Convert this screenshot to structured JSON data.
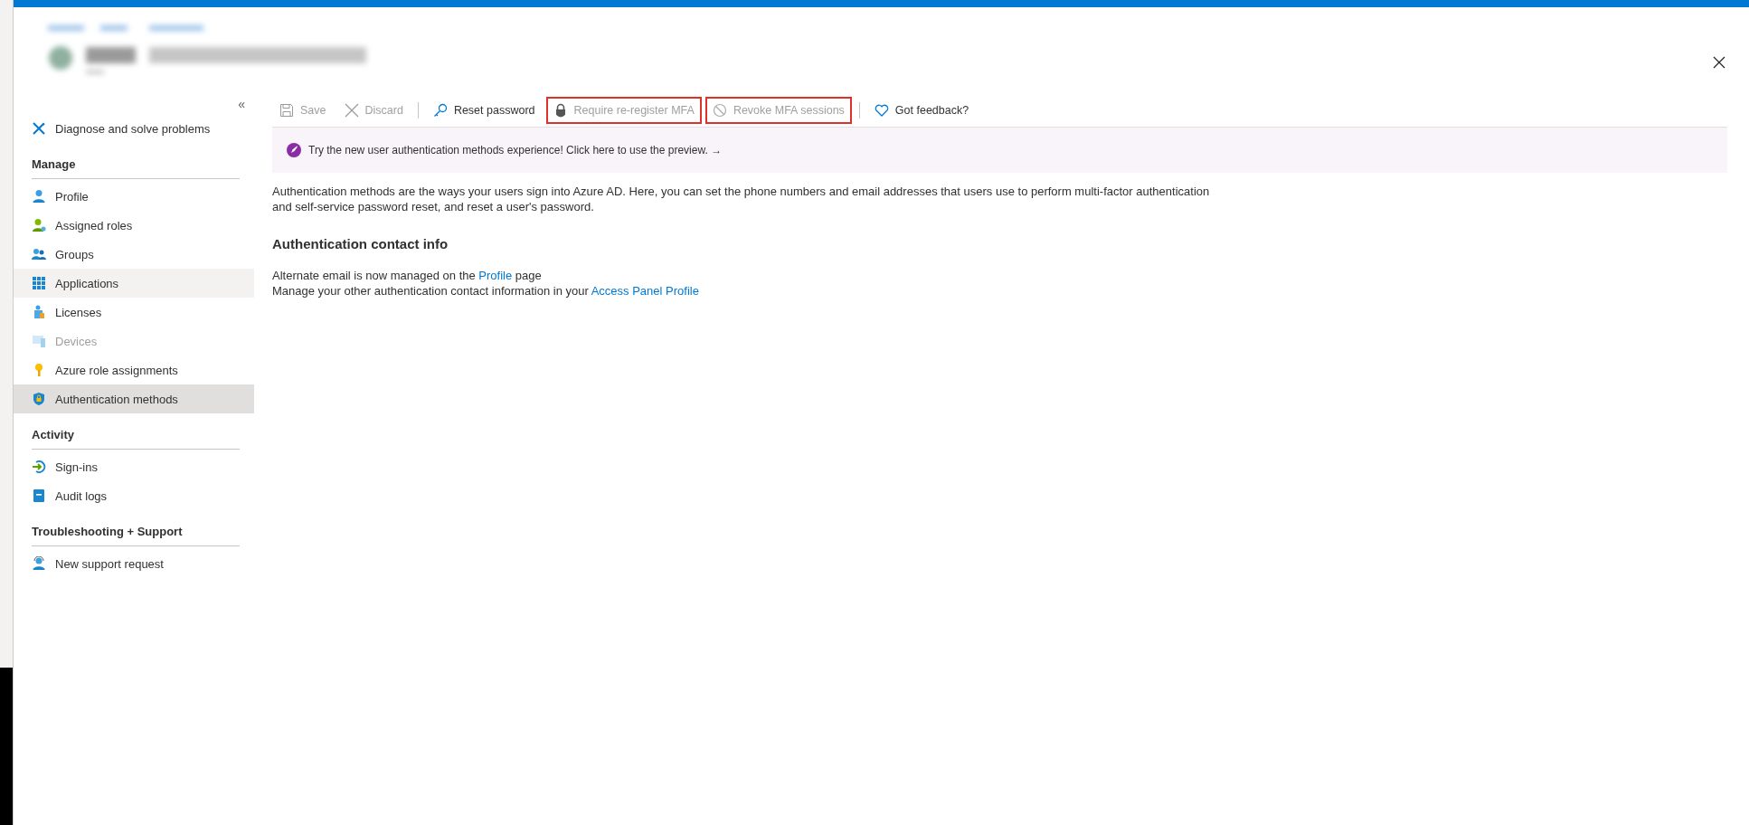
{
  "sidebar": {
    "collapse_glyph": "«",
    "items": [
      {
        "kind": "item",
        "label": "Diagnose and solve problems",
        "selected": false,
        "hovered": false,
        "disabled": false
      },
      {
        "kind": "header",
        "label": "Manage"
      },
      {
        "kind": "item",
        "label": "Profile",
        "selected": false,
        "hovered": false,
        "disabled": false
      },
      {
        "kind": "item",
        "label": "Assigned roles",
        "selected": false,
        "hovered": false,
        "disabled": false
      },
      {
        "kind": "item",
        "label": "Groups",
        "selected": false,
        "hovered": false,
        "disabled": false
      },
      {
        "kind": "item",
        "label": "Applications",
        "selected": false,
        "hovered": true,
        "disabled": false
      },
      {
        "kind": "item",
        "label": "Licenses",
        "selected": false,
        "hovered": false,
        "disabled": false
      },
      {
        "kind": "item",
        "label": "Devices",
        "selected": false,
        "hovered": false,
        "disabled": true
      },
      {
        "kind": "item",
        "label": "Azure role assignments",
        "selected": false,
        "hovered": false,
        "disabled": false
      },
      {
        "kind": "item",
        "label": "Authentication methods",
        "selected": true,
        "hovered": false,
        "disabled": false
      },
      {
        "kind": "header",
        "label": "Activity"
      },
      {
        "kind": "item",
        "label": "Sign-ins",
        "selected": false,
        "hovered": false,
        "disabled": false
      },
      {
        "kind": "item",
        "label": "Audit logs",
        "selected": false,
        "hovered": false,
        "disabled": false
      },
      {
        "kind": "header",
        "label": "Troubleshooting + Support"
      },
      {
        "kind": "item",
        "label": "New support request",
        "selected": false,
        "hovered": false,
        "disabled": false
      }
    ]
  },
  "toolbar": [
    {
      "label": "Save",
      "disabled": true,
      "outlined": false,
      "separator_before": false
    },
    {
      "label": "Discard",
      "disabled": true,
      "outlined": false,
      "separator_before": false
    },
    {
      "label": "Reset password",
      "disabled": false,
      "outlined": false,
      "separator_before": true
    },
    {
      "label": "Require re-register MFA",
      "disabled": true,
      "outlined": true,
      "separator_before": false
    },
    {
      "label": "Revoke MFA sessions",
      "disabled": true,
      "outlined": true,
      "separator_before": false
    },
    {
      "label": "Got feedback?",
      "disabled": false,
      "outlined": false,
      "separator_before": true
    }
  ],
  "banner": {
    "text": "Try the new user authentication methods experience! Click here to use the preview. →"
  },
  "description": "Authentication methods are the ways your users sign into Azure AD. Here, you can set the phone numbers and email addresses that users use to perform multi-factor authentication and self-service password reset, and reset a user's password.",
  "section_title": "Authentication contact info",
  "contact_lines": [
    [
      {
        "text": "Alternate email is now managed on the ",
        "link": false
      },
      {
        "text": "Profile",
        "link": true
      },
      {
        "text": " page",
        "link": false
      }
    ],
    [
      {
        "text": "Manage your other authentication contact information in your ",
        "link": false
      },
      {
        "text": "Access Panel Profile",
        "link": true
      }
    ]
  ]
}
